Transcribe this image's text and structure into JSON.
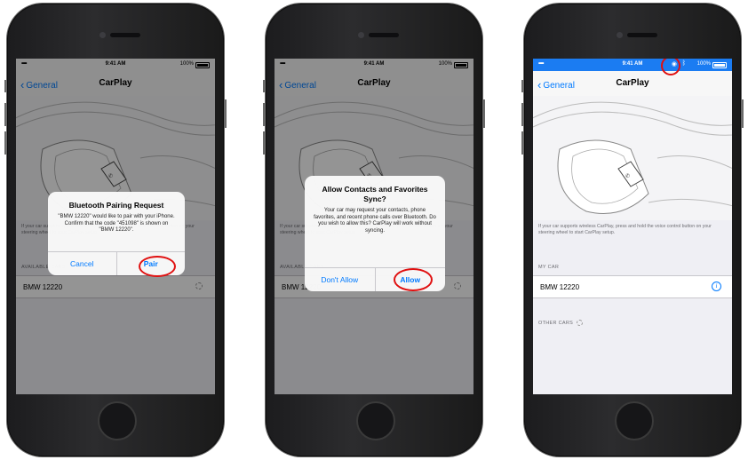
{
  "status_bar": {
    "carrier": "•••••",
    "time": "9:41 AM",
    "battery": "100%",
    "bluetooth_icon": "bluetooth-icon",
    "colors": {
      "default": "#f7f7f7",
      "connected": "#1b7cf2"
    }
  },
  "nav": {
    "back_label": "General",
    "title": "CarPlay"
  },
  "carplay_description": "If your car supports wireless CarPlay, press and hold the voice control button on your steering wheel to start CarPlay setup.",
  "available_cars_header": "AVAILABLE CARS",
  "my_car_header": "MY CAR",
  "other_cars_header": "OTHER CARS",
  "car_name": "BMW 12220",
  "alerts": {
    "bluetooth_pairing": {
      "title": "Bluetooth Pairing Request",
      "message": "\"BMW 12220\" would like to pair with your iPhone. Confirm that the code \"451098\" is shown on \"BMW 12220\".",
      "cancel_label": "Cancel",
      "confirm_label": "Pair"
    },
    "contacts_sync": {
      "title": "Allow Contacts and Favorites Sync?",
      "message": "Your car may request your contacts, phone favorites, and recent phone calls over Bluetooth. Do you wish to allow this? CarPlay will work without syncing.",
      "deny_label": "Don't Allow",
      "allow_label": "Allow"
    }
  },
  "icons": {
    "back": "chevron-left-icon",
    "info": "info-icon",
    "spinner": "activity-spinner-icon"
  },
  "accent_colors": {
    "ios_blue": "#007aff",
    "highlight_ring": "#e01010"
  }
}
